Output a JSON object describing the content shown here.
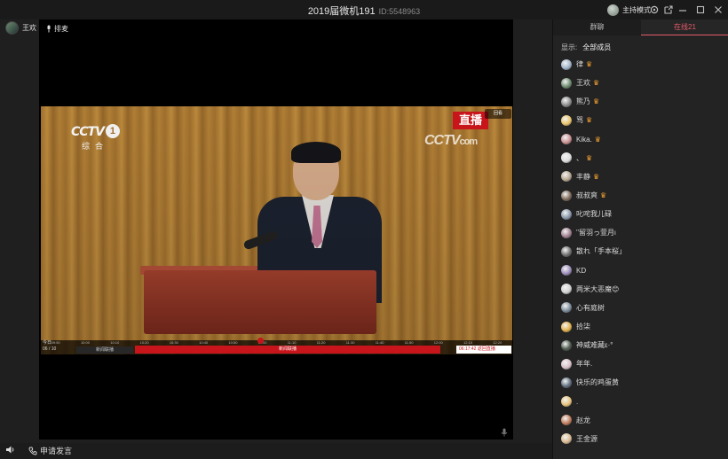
{
  "titlebar": {
    "title": "2019届微机191",
    "id_label": "ID:5548963",
    "host_mode": "主持模式",
    "icons": [
      "settings-icon",
      "popout-icon",
      "minimize-icon",
      "maximize-icon",
      "close-icon"
    ]
  },
  "presenter": {
    "name": "王欢"
  },
  "mic_tag": {
    "label": "排麦"
  },
  "video": {
    "channel_wordmark": "CCTV",
    "channel_number": "1",
    "channel_sub": "综合",
    "live_label": "直播",
    "site_wordmark": "CCTV",
    "site_suffix": "com",
    "timeshift_label": "回看",
    "timeline": {
      "today_label": "今日",
      "date_label": "06 / 10",
      "ticks": [
        "09:50",
        "10:00",
        "10:10",
        "10:20",
        "10:30",
        "10:40",
        "10:50",
        "11:00",
        "11:10",
        "11:20",
        "11:30",
        "11:40",
        "11:50",
        "12:00",
        "12:10",
        "12:20"
      ],
      "left_program": "新闻联播",
      "current_program": "新闻联播",
      "right_status": "06:17:42  返回直播"
    }
  },
  "bottombar": {
    "apply_label": "申请发言"
  },
  "sidebar": {
    "tabs": [
      {
        "label": "群聊"
      },
      {
        "label": "在线21"
      }
    ],
    "filter_label": "显示:",
    "filter_value": "全部成员",
    "members": [
      {
        "name": "律",
        "badge": "♛",
        "color": "#9fb3c8"
      },
      {
        "name": "王欢",
        "badge": "♛",
        "color": "#6d8b6f"
      },
      {
        "name": "熊乃",
        "badge": "♛",
        "color": "#8a8a8a"
      },
      {
        "name": "骂",
        "badge": "♛",
        "color": "#e8c46a"
      },
      {
        "name": "Kika.",
        "badge": "♛",
        "color": "#c98f8f"
      },
      {
        "name": "、",
        "badge": "♛",
        "color": "#dddddd"
      },
      {
        "name": "丰静",
        "badge": "♛",
        "color": "#b5a58f"
      },
      {
        "name": "叔叔爽",
        "badge": "♛",
        "color": "#7e6b5a"
      },
      {
        "name": "叱咤我儿碌",
        "badge": "",
        "color": "#8796a8"
      },
      {
        "name": "''留羽っ萱月ι",
        "badge": "",
        "color": "#a07f8f"
      },
      {
        "name": "散れ「手本桜」",
        "badge": "",
        "color": "#6f6f6f"
      },
      {
        "name": "KD",
        "badge": "",
        "color": "#9a8ab8"
      },
      {
        "name": "两米大恶魔😊",
        "badge": "",
        "color": "#d0d0d0"
      },
      {
        "name": "心有庭树",
        "badge": "",
        "color": "#7a8a9a"
      },
      {
        "name": "拾柒",
        "badge": "",
        "color": "#e0b04a"
      },
      {
        "name": "神威难藏ε·°",
        "badge": "",
        "color": "#4f5a4f"
      },
      {
        "name": "年年.",
        "badge": "",
        "color": "#d8c0c8"
      },
      {
        "name": "快乐的鸡蛋黄",
        "badge": "",
        "color": "#5f6f7f"
      },
      {
        "name": ".",
        "badge": "",
        "color": "#e6c27a"
      },
      {
        "name": "赵龙",
        "badge": "",
        "color": "#c07a5a"
      },
      {
        "name": "王金源",
        "badge": "",
        "color": "#d8b890"
      }
    ]
  }
}
